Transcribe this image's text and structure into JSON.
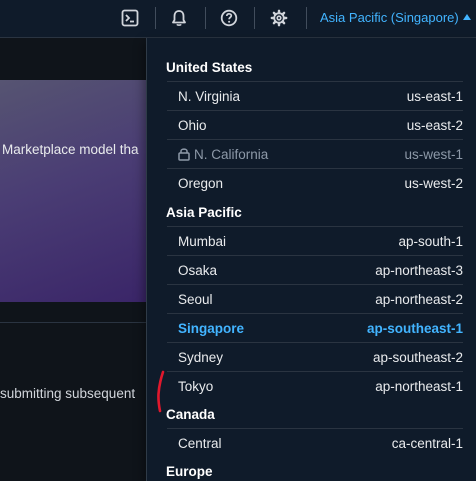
{
  "header": {
    "icons": [
      {
        "name": "cloudshell-icon"
      },
      {
        "name": "notifications-icon"
      },
      {
        "name": "help-icon"
      },
      {
        "name": "settings-icon"
      }
    ],
    "region_selector": {
      "label": "Asia Pacific (Singapore)",
      "accent_color": "#42b4ff"
    }
  },
  "background": {
    "banner_text": "Marketplace model tha",
    "body_text": "submitting subsequent"
  },
  "region_menu": {
    "groups": [
      {
        "label": "United States",
        "regions": [
          {
            "name": "N. Virginia",
            "code": "us-east-1"
          },
          {
            "name": "Ohio",
            "code": "us-east-2"
          },
          {
            "name": "N. California",
            "code": "us-west-1",
            "state": "disabled",
            "icon": "lock-icon"
          },
          {
            "name": "Oregon",
            "code": "us-west-2"
          }
        ]
      },
      {
        "label": "Asia Pacific",
        "regions": [
          {
            "name": "Mumbai",
            "code": "ap-south-1"
          },
          {
            "name": "Osaka",
            "code": "ap-northeast-3"
          },
          {
            "name": "Seoul",
            "code": "ap-northeast-2"
          },
          {
            "name": "Singapore",
            "code": "ap-southeast-1",
            "state": "selected"
          },
          {
            "name": "Sydney",
            "code": "ap-southeast-2"
          },
          {
            "name": "Tokyo",
            "code": "ap-northeast-1"
          }
        ]
      },
      {
        "label": "Canada",
        "regions": [
          {
            "name": "Central",
            "code": "ca-central-1"
          }
        ]
      },
      {
        "label": "Europe",
        "regions": []
      }
    ],
    "colors": {
      "selected": "#42b4ff",
      "disabled": "#8d99a8",
      "annotation_mark": "#e0182d"
    }
  }
}
